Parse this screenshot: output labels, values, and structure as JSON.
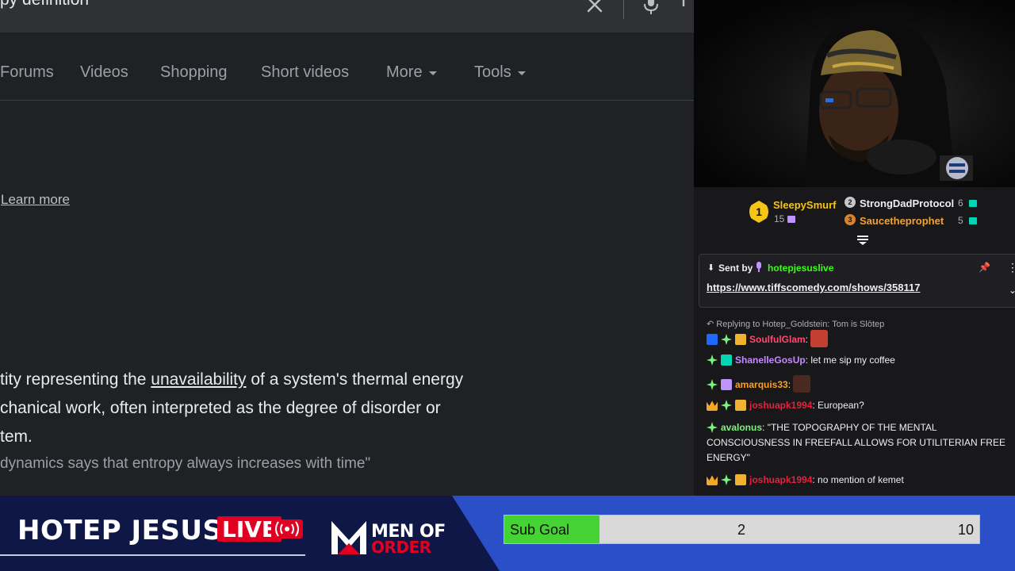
{
  "search": {
    "query": "py definition",
    "tabs": [
      {
        "label": "Forums"
      },
      {
        "label": "Videos"
      },
      {
        "label": "Shopping"
      },
      {
        "label": "Short videos"
      },
      {
        "label": "More"
      },
      {
        "label": "Tools"
      }
    ],
    "learn_more": "Learn more",
    "definition": {
      "line1_pre": "tity representing the ",
      "line1_link": "unavailability",
      "line1_post": " of a system's thermal energy",
      "line2": "chanical work, often interpreted as the degree of disorder or",
      "line3": "tem.",
      "example": "dynamics says that entropy always increases with time\""
    }
  },
  "chat": {
    "leaderboard": {
      "first": {
        "rank": "1",
        "name": "SleepySmurf",
        "count": "15"
      },
      "second": {
        "rank": "2",
        "name": "StrongDadProtocol",
        "count": "6"
      },
      "third": {
        "rank": "3",
        "name": "Saucetheprophet",
        "count": "5"
      }
    },
    "pinned": {
      "sent_by_label": "Sent by",
      "user": "hotepjesuslive",
      "link": "https://www.tiffscomedy.com/shows/358117"
    },
    "reply_context": "Replying to Hotep_Goldstein: Tom is Slōtep",
    "messages": [
      {
        "user": "SoulfulGlam",
        "user_color": "#ff4a6e",
        "text": ""
      },
      {
        "user": "ShanelleGosUp",
        "user_color": "#c58aff",
        "text": "let me sip my coffee"
      },
      {
        "user": "amarquis33",
        "user_color": "#ff9f1a",
        "text": ""
      },
      {
        "user": "joshuapk1994",
        "user_color": "#e5213c",
        "text": "European?"
      },
      {
        "user": "avalonus",
        "user_color": "#7cf37c",
        "text": "\"THE TOPOGRAPHY OF THE MENTAL CONSCIOUSNESS IN FREEFALL ALLOWS FOR UTILITERIAN FREE ENERGY\""
      },
      {
        "user": "joshuapk1994",
        "user_color": "#e5213c",
        "text": "no mention of kemet"
      }
    ]
  },
  "banner": {
    "title": "HOTEP JESUS",
    "live": "LIVE",
    "brand_line1": "MEN OF",
    "brand_line2": "ORDER",
    "sub_goal": {
      "label": "Sub Goal",
      "current": "2",
      "target": "10",
      "progress": 0.2
    }
  },
  "colors": {
    "search_bg": "#202124",
    "chat_bg": "#18181b",
    "banner_blue": "#2a4fc6",
    "banner_navy": "#0f1747",
    "live_red": "#e00022",
    "goal_green": "#45d233",
    "gold": "#f5c518"
  }
}
